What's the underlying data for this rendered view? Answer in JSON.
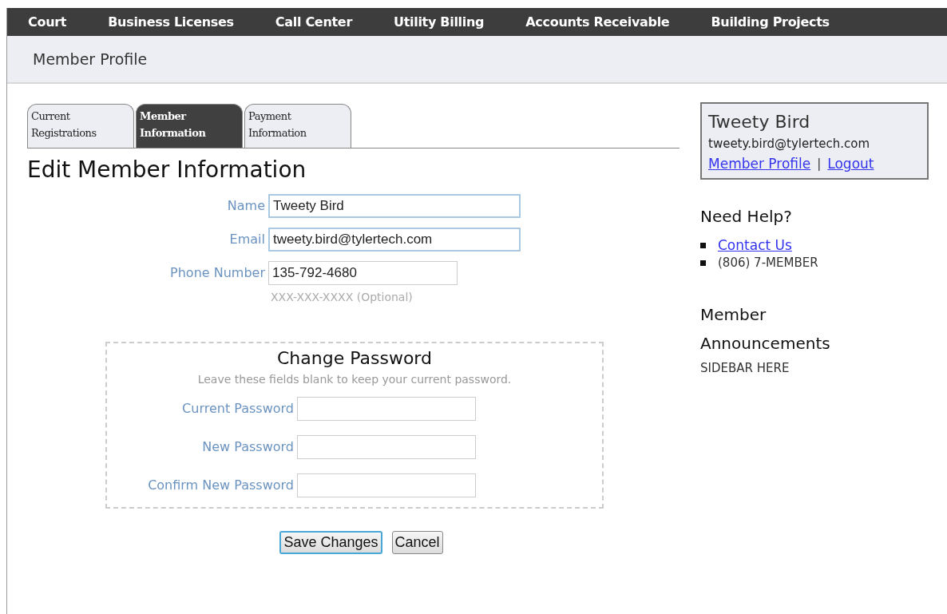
{
  "nav": [
    "Court",
    "Business Licenses",
    "Call Center",
    "Utility Billing",
    "Accounts Receivable",
    "Building Projects"
  ],
  "header": {
    "title": "Member Profile"
  },
  "tabs": [
    {
      "label": "Current Registrations",
      "selected": false
    },
    {
      "label": "Member Information",
      "selected": true
    },
    {
      "label": "Payment Information",
      "selected": false
    }
  ],
  "heading": "Edit Member Information",
  "fields": [
    {
      "label": "Name",
      "value": "Tweety Bird",
      "focused": true
    },
    {
      "label": "Email",
      "value": "tweety.bird@tylertech.com",
      "focused": true
    },
    {
      "label": "Phone Number",
      "value": "135-792-4680",
      "focused": false,
      "hint": "XXX-XXX-XXXX (Optional)"
    }
  ],
  "password": {
    "title": "Change Password",
    "note": "Leave these fields blank to keep your current password.",
    "fields": [
      {
        "label": "Current Password"
      },
      {
        "label": "New Password"
      },
      {
        "label": "Confirm New Password"
      }
    ]
  },
  "buttons": [
    {
      "label": "Save Changes",
      "focused": true
    },
    {
      "label": "Cancel",
      "focused": false
    }
  ],
  "account": {
    "name": "Tweety Bird",
    "email": "tweety.bird@tylertech.com",
    "links": [
      "Member Profile",
      "Logout"
    ],
    "separator": "|"
  },
  "help": {
    "title": "Need Help?",
    "items": [
      {
        "kind": "link",
        "text": "Contact Us"
      },
      {
        "kind": "text",
        "text": "(806) 7-MEMBER"
      }
    ]
  },
  "announcements": {
    "title": "Member Announcements",
    "body": "SIDEBAR HERE"
  }
}
